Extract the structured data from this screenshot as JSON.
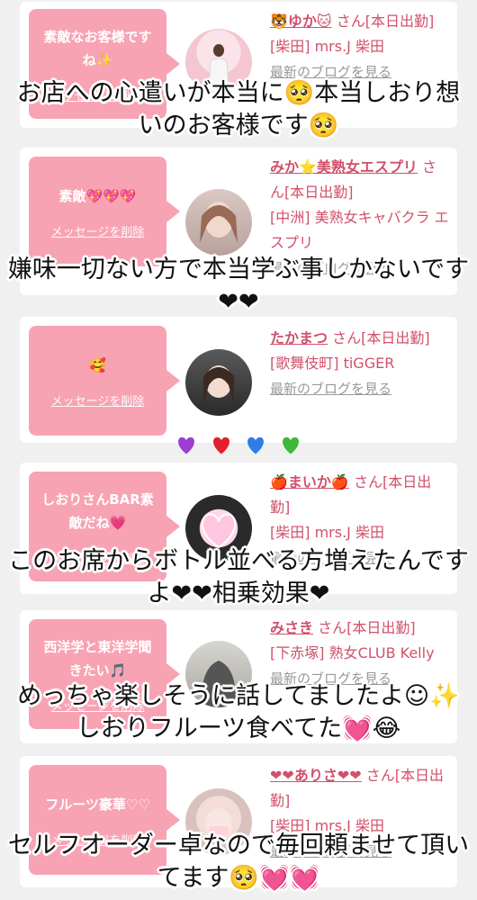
{
  "cards": [
    {
      "bubble_text": "素敵なお客様ですね✨",
      "delete_label": "メッセージを削除",
      "girl_name": "🐯ゆか🐱",
      "san_label": "さん[本日出勤]",
      "shop": "[柴田] mrs.J 柴田",
      "blog_label": "最新のブログを見る"
    },
    {
      "bubble_text": "素敵💖💖💖",
      "delete_label": "メッセージを削除",
      "girl_name": "みか⭐美熟女エスプリ",
      "san_label": "さん[本日出勤]",
      "shop": "[中洲] 美熟女キャバクラ エスプリ",
      "blog_label": "最新のブログを見る"
    },
    {
      "bubble_text": "🥰",
      "delete_label": "メッセージを削除",
      "girl_name": "たかまつ",
      "san_label": "さん[本日出勤]",
      "shop": "[歌舞伎町] tiGGER",
      "blog_label": "最新のブログを見る"
    },
    {
      "bubble_text": "しおりさんBAR素敵だね💗",
      "delete_label": "メッセージを削除",
      "girl_name": "🍎まいか🍎",
      "san_label": "さん[本日出勤]",
      "shop": "[柴田] mrs.J 柴田",
      "blog_label": "最新のブログを見る"
    },
    {
      "bubble_text": "西洋学と東洋学聞きたい🎵",
      "delete_label": "メッセージを削除",
      "girl_name": "みさき",
      "san_label": "さん[本日出勤]",
      "shop": "[下赤塚] 熟女CLUB Kelly",
      "blog_label": "最新のブログを見る"
    },
    {
      "bubble_text": "フルーツ豪華♡♡",
      "delete_label": "メッセージを削除",
      "girl_name": "❤❤ありさ❤❤",
      "san_label": "さん[本日出勤]",
      "shop": "[柴田] mrs.J 柴田",
      "blog_label": "最新のブログを見る"
    }
  ],
  "overlays": [
    "お店への心遣いが本当に🥺本当しおり想いのお客様です🥺",
    "嫌味一切ない方で本当学ぶ事しかないです❤❤",
    "このお席からボトル並べる方増えたんですよ❤❤相乗効果❤",
    "めっちゃ楽しそうに話してましたよ☺✨しおりフルーツ食べてた💓😂",
    "セルフオーダー卓なので毎回頼ませて頂いてます🥺💓💓"
  ],
  "hearts_row": {
    "colors": [
      "#9b3fd1",
      "#e0202c",
      "#2f7ee6",
      "#3fb83a"
    ]
  },
  "colors": {
    "bubble": "#f7a3b3",
    "name": "#d2506a",
    "background": "#f0f0f0"
  }
}
